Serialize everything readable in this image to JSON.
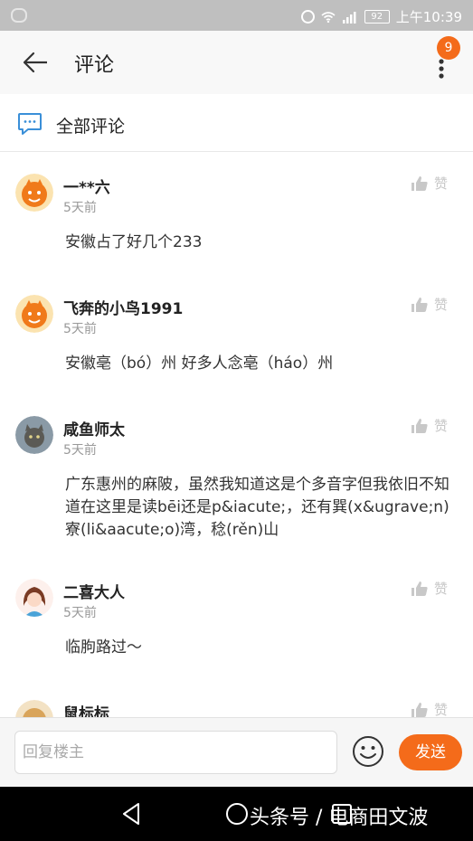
{
  "status_bar": {
    "battery": "92",
    "time": "上午10:39"
  },
  "header": {
    "title": "评论",
    "badge_count": "9"
  },
  "section": {
    "title": "全部评论"
  },
  "comments": [
    {
      "name": "一**六",
      "time": "5天前",
      "text": "安徽占了好几个233",
      "like_label": "赞",
      "avatar": "orange-mascot"
    },
    {
      "name": "飞奔的小鸟1991",
      "time": "5天前",
      "text": "安徽亳（bó）州   好多人念亳（háo）州",
      "like_label": "赞",
      "avatar": "orange-mascot"
    },
    {
      "name": "咸鱼师太",
      "time": "5天前",
      "text": "广东惠州的麻陂，虽然我知道这是个多音字但我依旧不知道在这里是读bēi还是p&iacute;，还有巽(x&ugrave;n)寮(li&aacute;o)湾，稔(rěn)山",
      "like_label": "赞",
      "avatar": "cat-photo"
    },
    {
      "name": "二喜大人",
      "time": "5天前",
      "text": "临朐路过～",
      "like_label": "赞",
      "avatar": "girl-cartoon"
    },
    {
      "name": "鼠标标",
      "time": "",
      "text": "",
      "like_label": "赞",
      "avatar": "dog-photo"
    }
  ],
  "reply": {
    "placeholder": "回复楼主",
    "send_label": "发送"
  },
  "watermark": "头条号 / 电商田文波",
  "colors": {
    "accent": "#f46b1a",
    "header_bg": "#f8f8f8",
    "status_bar_bg": "#bfbfbf"
  }
}
